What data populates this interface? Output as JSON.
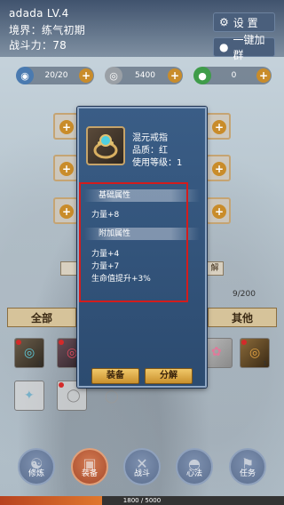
{
  "player": {
    "name_level": "adada LV.4",
    "realm": "境界：练气初期",
    "power": "战斗力：78"
  },
  "header_buttons": {
    "settings": "设 置",
    "join_group": "一键加群"
  },
  "resources": [
    {
      "icon": "energy-icon",
      "value": "20/20",
      "color": "#4a7ab0"
    },
    {
      "icon": "silver-icon",
      "value": "5400",
      "color": "#9aa0a6"
    },
    {
      "icon": "jade-icon",
      "value": "0",
      "color": "#3f9c4a"
    }
  ],
  "inventory": {
    "capacity": "9/200",
    "tab_all": "全部",
    "tab_other": "其他"
  },
  "item_modal": {
    "name": "混元戒指",
    "quality": "品质：红",
    "use_level": "使用等级：1",
    "base_title": "基础属性",
    "base_attrs": [
      "力量+8"
    ],
    "extra_title": "附加属性",
    "extra_attrs": [
      "力量+4",
      "力量+7",
      "生命值提升+3%"
    ],
    "equip_label": "装备",
    "decompose_label": "分解"
  },
  "nav": [
    {
      "label": "修炼",
      "icon": "meditate-icon"
    },
    {
      "label": "装备",
      "icon": "armor-icon"
    },
    {
      "label": "战斗",
      "icon": "swords-icon"
    },
    {
      "label": "心法",
      "icon": "helmet-icon"
    },
    {
      "label": "任务",
      "icon": "flag-icon"
    }
  ],
  "xp": {
    "text": "1800 / 5000",
    "fraction": 0.36
  },
  "colors": {
    "highlight_box": "#d31c1c",
    "nav_active": "#a74a2a",
    "button_gold": "#c9902c"
  }
}
